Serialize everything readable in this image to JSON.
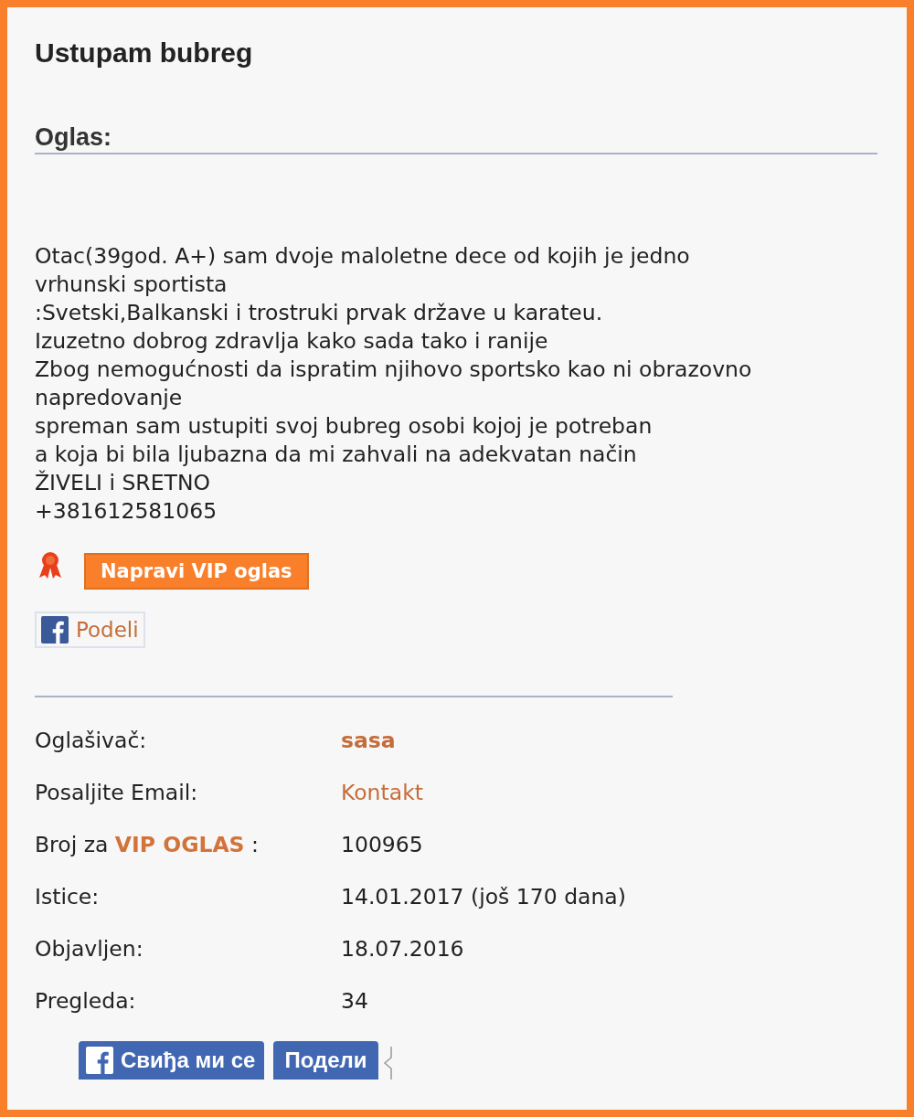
{
  "title": "Ustupam bubreg",
  "section_heading": "Oglas:",
  "ad_lines": [
    "Otac(39god. A+) sam dvoje maloletne dece od kojih je jedno",
    "vrhunski sportista",
    ":Svetski,Balkanski i trostruki prvak države u karateu.",
    "Izuzetno dobrog zdravlja kako sada tako i ranije",
    "Zbog nemogućnosti da ispratim njihovo sportsko kao ni obrazovno",
    "napredovanje",
    "spreman sam ustupiti svoj bubreg osobi kojoj je potreban",
    "a koja bi bila ljubazna da mi zahvali na adekvatan način",
    "ŽIVELI i SRETNO",
    "+381612581065"
  ],
  "vip_button": "Napravi VIP oglas",
  "share_button": "Podeli",
  "details": [
    {
      "label": "Oglašivač:",
      "value": "sasa",
      "kind": "strong-link"
    },
    {
      "label": "Posaljite Email:",
      "value": "Kontakt",
      "kind": "link"
    },
    {
      "label": "Broj za **VIP OGLAS** :",
      "value": "100965",
      "kind": "text"
    },
    {
      "label": "Istice:",
      "value": "14.01.2017 (još 170 dana)",
      "kind": "text"
    },
    {
      "label": "Objavljen:",
      "value": "18.07.2016",
      "kind": "text"
    },
    {
      "label": "Pregleda:",
      "value": "34",
      "kind": "text"
    }
  ],
  "social": {
    "like": "Свиђа ми се",
    "share": "Подели"
  }
}
